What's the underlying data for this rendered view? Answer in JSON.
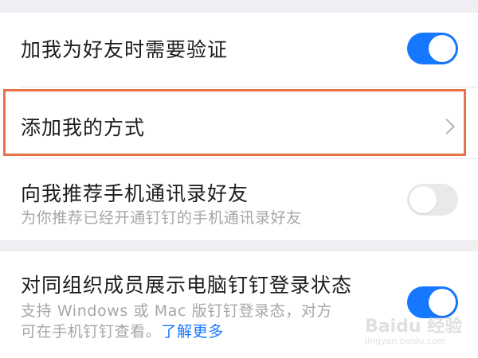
{
  "settings": {
    "verify_friend": {
      "title": "加我为好友时需要验证",
      "enabled": true
    },
    "add_method": {
      "title": "添加我的方式"
    },
    "recommend_contacts": {
      "title": "向我推荐手机通讯录好友",
      "subtitle": "为你推荐已经开通钉钉的手机通讯录好友",
      "enabled": false
    },
    "login_status": {
      "title": "对同组织成员展示电脑钉钉登录状态",
      "desc_line1": "支持 Windows 或 Mac 版钉钉登录态，对方",
      "desc_line2": "可在手机钉钉查看。",
      "link": "了解更多",
      "enabled": true
    }
  },
  "watermark": {
    "logo": "Baidu 经验",
    "url": "jingyan.baidu.com"
  },
  "colors": {
    "accent": "#1677ff",
    "highlight": "#e8734a",
    "toggle_off": "#e9e9eb",
    "background": "#efeff3"
  }
}
